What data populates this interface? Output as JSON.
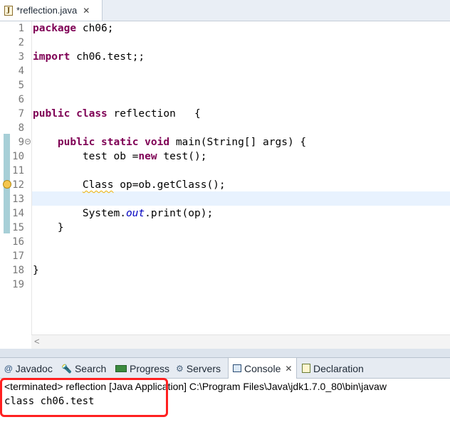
{
  "editor": {
    "tab": {
      "title": "*reflection.java",
      "close": "✕"
    },
    "lines": [
      {
        "n": "1",
        "tokens": [
          {
            "t": "package",
            "c": "kw"
          },
          {
            "t": " ch06;"
          }
        ]
      },
      {
        "n": "2",
        "tokens": []
      },
      {
        "n": "3",
        "tokens": [
          {
            "t": "import",
            "c": "kw"
          },
          {
            "t": " ch06.test;;"
          }
        ]
      },
      {
        "n": "4",
        "tokens": []
      },
      {
        "n": "5",
        "tokens": []
      },
      {
        "n": "6",
        "tokens": []
      },
      {
        "n": "7",
        "tokens": [
          {
            "t": "public",
            "c": "kw"
          },
          {
            "t": " "
          },
          {
            "t": "class",
            "c": "kw"
          },
          {
            "t": " reflection   {"
          }
        ]
      },
      {
        "n": "8",
        "tokens": []
      },
      {
        "n": "9",
        "fold": true,
        "tokens": [
          {
            "t": "    "
          },
          {
            "t": "public",
            "c": "kw"
          },
          {
            "t": " "
          },
          {
            "t": "static",
            "c": "kw"
          },
          {
            "t": " "
          },
          {
            "t": "void",
            "c": "kw"
          },
          {
            "t": " main(String[] args) {"
          }
        ]
      },
      {
        "n": "10",
        "tokens": [
          {
            "t": "        test ob ="
          },
          {
            "t": "new",
            "c": "kw"
          },
          {
            "t": " test();"
          }
        ]
      },
      {
        "n": "11",
        "tokens": []
      },
      {
        "n": "12",
        "warning": true,
        "tokens": [
          {
            "t": "        "
          },
          {
            "t": "Class",
            "c": "squiggle"
          },
          {
            "t": " op=ob.getClass();"
          }
        ]
      },
      {
        "n": "13",
        "current": true,
        "tokens": []
      },
      {
        "n": "14",
        "tokens": [
          {
            "t": "        System."
          },
          {
            "t": "out",
            "c": "field"
          },
          {
            "t": ".print(op);"
          }
        ]
      },
      {
        "n": "15",
        "tokens": [
          {
            "t": "    }"
          }
        ]
      },
      {
        "n": "16",
        "tokens": []
      },
      {
        "n": "17",
        "tokens": []
      },
      {
        "n": "18",
        "tokens": [
          {
            "t": "}"
          }
        ]
      },
      {
        "n": "19",
        "tokens": []
      }
    ],
    "scroll_left": "<"
  },
  "views": {
    "tabs": [
      {
        "id": "javadoc",
        "label": "Javadoc",
        "icon": "at-icon",
        "glyph": "@"
      },
      {
        "id": "search",
        "label": "Search",
        "icon": "search-icon",
        "glyph": "🔦"
      },
      {
        "id": "progress",
        "label": "Progress",
        "icon": "progress-icon",
        "glyph": ""
      },
      {
        "id": "servers",
        "label": "Servers",
        "icon": "servers-icon",
        "glyph": "⚙"
      },
      {
        "id": "console",
        "label": "Console",
        "icon": "console-icon",
        "glyph": "",
        "active": true,
        "close": "✕"
      },
      {
        "id": "declaration",
        "label": "Declaration",
        "icon": "decl-icon",
        "glyph": ""
      }
    ]
  },
  "console": {
    "header": "<terminated> reflection [Java Application] C:\\Program Files\\Java\\jdk1.7.0_80\\bin\\javaw",
    "output": "class ch06.test"
  },
  "colors": {
    "keyword": "#7f0055",
    "field": "#0000c0",
    "highlight_border": "#ff2020",
    "current_line": "#e8f2fe"
  }
}
